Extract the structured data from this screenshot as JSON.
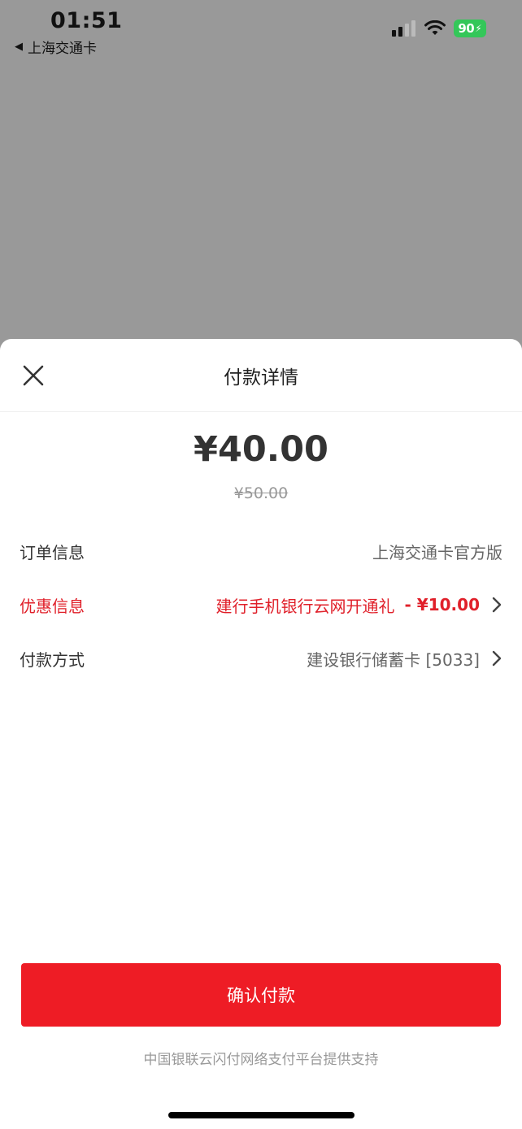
{
  "status_bar": {
    "time": "01:51",
    "back_app": "上海交通卡",
    "battery": "90"
  },
  "sheet": {
    "title": "付款详情",
    "amount": "¥40.00",
    "original_amount": "¥50.00",
    "rows": {
      "order": {
        "label": "订单信息",
        "value": "上海交通卡官方版"
      },
      "promo": {
        "label": "优惠信息",
        "value": "建行手机银行云网开通礼",
        "amount": "- ¥10.00"
      },
      "payment": {
        "label": "付款方式",
        "value": "建设银行储蓄卡 [5033]"
      }
    },
    "confirm_label": "确认付款",
    "footer": "中国银联云闪付网络支付平台提供支持"
  },
  "colors": {
    "accent": "#ee1c25",
    "promo_text": "#e0202a",
    "overlay": "#999999",
    "battery": "#34c759"
  },
  "icons": {
    "close": "close-icon",
    "chevron": "chevron-right-icon",
    "signal": "cellular-signal-icon",
    "wifi": "wifi-icon",
    "battery": "battery-charging-icon"
  }
}
